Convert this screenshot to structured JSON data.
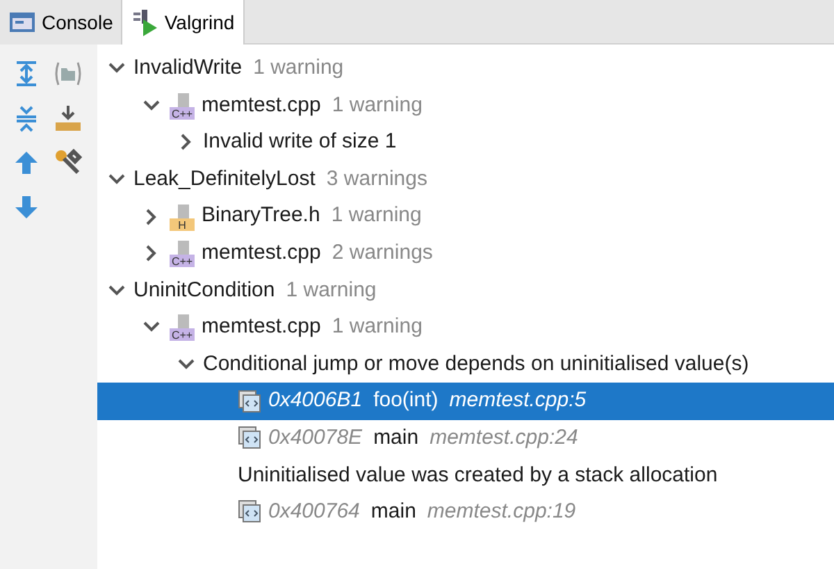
{
  "tabs": [
    {
      "label": "Console",
      "selected": false
    },
    {
      "label": "Valgrind",
      "selected": true
    }
  ],
  "tree": [
    {
      "kind": "group",
      "label": "InvalidWrite",
      "count": "1 warning",
      "expanded": true,
      "children": [
        {
          "kind": "file",
          "filetype": "C++",
          "label": "memtest.cpp",
          "count": "1 warning",
          "expanded": true,
          "children": [
            {
              "kind": "message",
              "label": "Invalid write of size 1",
              "expanded": false
            }
          ]
        }
      ]
    },
    {
      "kind": "group",
      "label": "Leak_DefinitelyLost",
      "count": "3 warnings",
      "expanded": true,
      "children": [
        {
          "kind": "file",
          "filetype": "H",
          "label": "BinaryTree.h",
          "count": "1 warning",
          "expanded": false
        },
        {
          "kind": "file",
          "filetype": "C++",
          "label": "memtest.cpp",
          "count": "2 warnings",
          "expanded": false
        }
      ]
    },
    {
      "kind": "group",
      "label": "UninitCondition",
      "count": "1 warning",
      "expanded": true,
      "children": [
        {
          "kind": "file",
          "filetype": "C++",
          "label": "memtest.cpp",
          "count": "1 warning",
          "expanded": true,
          "children": [
            {
              "kind": "message",
              "label": "Conditional jump or move depends on uninitialised value(s)",
              "expanded": true,
              "children": [
                {
                  "kind": "frame",
                  "address": "0x4006B1",
                  "function": "foo(int)",
                  "location": "memtest.cpp:5",
                  "selected": true
                },
                {
                  "kind": "frame",
                  "address": "0x40078E",
                  "function": "main",
                  "location": "memtest.cpp:24",
                  "selected": false
                },
                {
                  "kind": "note",
                  "label": "Uninitialised value was created by a stack allocation"
                },
                {
                  "kind": "frame",
                  "address": "0x400764",
                  "function": "main",
                  "location": "memtest.cpp:19",
                  "selected": false
                }
              ]
            }
          ]
        }
      ]
    }
  ]
}
